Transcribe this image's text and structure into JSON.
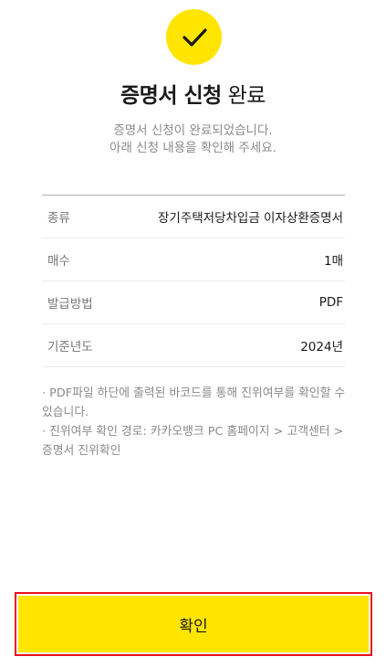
{
  "header": {
    "title_bold": "증명서 신청",
    "title_regular": "완료",
    "subtitle_line1": "증명서 신청이 완료되었습니다.",
    "subtitle_line2": "아래 신청 내용을 확인해 주세요.",
    "icon": "check-icon",
    "accent_color": "#ffe500"
  },
  "details": [
    {
      "label": "종류",
      "value": "장기주택저당차입금 이자상환증명서"
    },
    {
      "label": "매수",
      "value": "1매"
    },
    {
      "label": "발급방법",
      "value": "PDF"
    },
    {
      "label": "기준년도",
      "value": "2024년"
    }
  ],
  "notes": {
    "line1": "· PDF파일 하단에 출력된 바코드를 통해 진위여부를 확인할 수",
    "line2": "있습니다.",
    "line3": "· 진위여부 확인 경로: 카카오뱅크 PC 홈페이지 > 고객센터 >",
    "line4": "증명서 진위확인"
  },
  "footer": {
    "confirm_label": "확인"
  }
}
